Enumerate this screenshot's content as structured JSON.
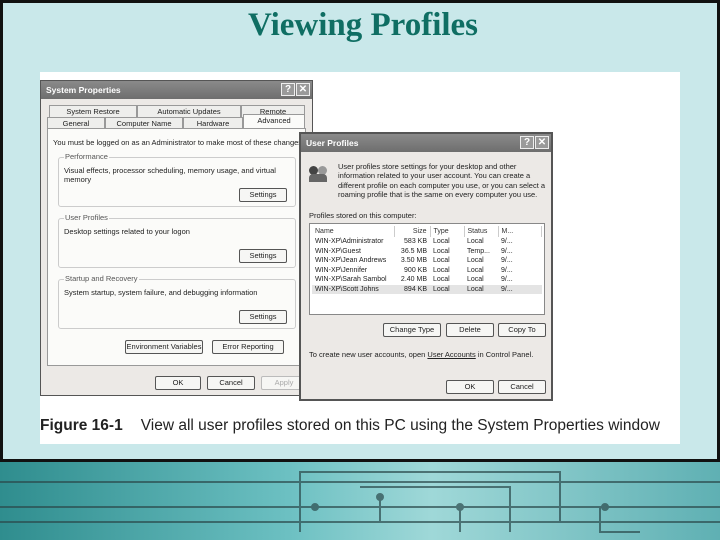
{
  "slide_title": "Viewing Profiles",
  "caption": {
    "label": "Figure 16-1",
    "text": "View all user profiles stored on this PC using the System Properties window"
  },
  "sysprops": {
    "title": "System Properties",
    "tabs_back": [
      "System Restore",
      "Automatic Updates",
      "Remote"
    ],
    "tabs_front": [
      "General",
      "Computer Name",
      "Hardware",
      "Advanced"
    ],
    "active_tab": "Advanced",
    "admin_note": "You must be logged on as an Administrator to make most of these changes.",
    "groups": [
      {
        "label": "Performance",
        "desc": "Visual effects, processor scheduling, memory usage, and virtual memory",
        "button": "Settings"
      },
      {
        "label": "User Profiles",
        "desc": "Desktop settings related to your logon",
        "button": "Settings"
      },
      {
        "label": "Startup and Recovery",
        "desc": "System startup, system failure, and debugging information",
        "button": "Settings"
      }
    ],
    "env_button": "Environment Variables",
    "error_button": "Error Reporting",
    "ok": "OK",
    "cancel": "Cancel",
    "apply": "Apply"
  },
  "userprofiles": {
    "title": "User Profiles",
    "intro": "User profiles store settings for your desktop and other information related to your user account. You can create a different profile on each computer you use, or you can select a roaming profile that is the same on every computer you use.",
    "list_label": "Profiles stored on this computer:",
    "columns": [
      "Name",
      "Size",
      "Type",
      "Status",
      "M..."
    ],
    "rows": [
      [
        "WIN-XP\\Administrator",
        "583 KB",
        "Local",
        "Local",
        "9/..."
      ],
      [
        "WIN-XP\\Guest",
        "36.5 MB",
        "Local",
        "Temp...",
        "9/..."
      ],
      [
        "WIN-XP\\Jean Andrews",
        "3.50 MB",
        "Local",
        "Local",
        "9/..."
      ],
      [
        "WIN-XP\\Jennifer",
        "900 KB",
        "Local",
        "Local",
        "9/..."
      ],
      [
        "WIN-XP\\Sarah Sambol",
        "2.40 MB",
        "Local",
        "Local",
        "9/..."
      ],
      [
        "WIN-XP\\Scott Johns",
        "894 KB",
        "Local",
        "Local",
        "9/..."
      ]
    ],
    "selected_row": 5,
    "change_type": "Change Type",
    "delete": "Delete",
    "copy_to": "Copy To",
    "footer_pre": "To create new user accounts, open ",
    "footer_link": "User Accounts",
    "footer_post": " in Control Panel.",
    "ok": "OK",
    "cancel": "Cancel"
  },
  "help_glyph": "?",
  "close_glyph": "✕"
}
